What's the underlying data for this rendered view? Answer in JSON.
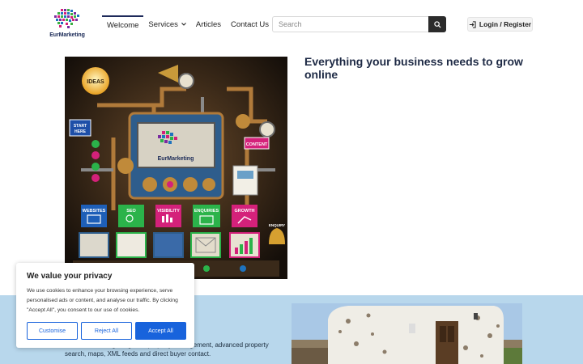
{
  "brand": {
    "name": "EurMarketing"
  },
  "nav": {
    "items": [
      {
        "label": "Welcome",
        "active": true
      },
      {
        "label": "Services",
        "has_dropdown": true
      },
      {
        "label": "Articles"
      },
      {
        "label": "Contact Us"
      }
    ]
  },
  "search": {
    "placeholder": "Search",
    "icon": "search-icon"
  },
  "auth": {
    "login_label": "Login / Register",
    "icon": "sign-in-icon"
  },
  "hero": {
    "heading": "Everything your business needs to grow online",
    "image": {
      "labels": {
        "ideas": "IDEAS",
        "start": "START",
        "here": "HERE",
        "content": "CONTENT",
        "websites": "WEBSITES",
        "seo": "SEO",
        "visibility": "VISIBILITY",
        "enquiries": "ENQUIRIES",
        "growth": "GROWTH",
        "enquiry": "ENQUIRY",
        "machine_brand": "EurMarketing"
      }
    }
  },
  "section2": {
    "text": "…ncies, including integrated property management, advanced property search, maps, XML feeds and direct buyer contact."
  },
  "cookie": {
    "title": "We value your privacy",
    "text": "We use cookies to enhance your browsing experience, serve personalised ads or content, and analyse our traffic. By clicking \"Accept All\", you consent to our use of cookies.",
    "buttons": {
      "customise": "Customise",
      "reject": "Reject All",
      "accept": "Accept All"
    }
  },
  "colors": {
    "accent": "#1863dc",
    "navy": "#1e2a45",
    "section_bg": "#b8d7ec"
  }
}
